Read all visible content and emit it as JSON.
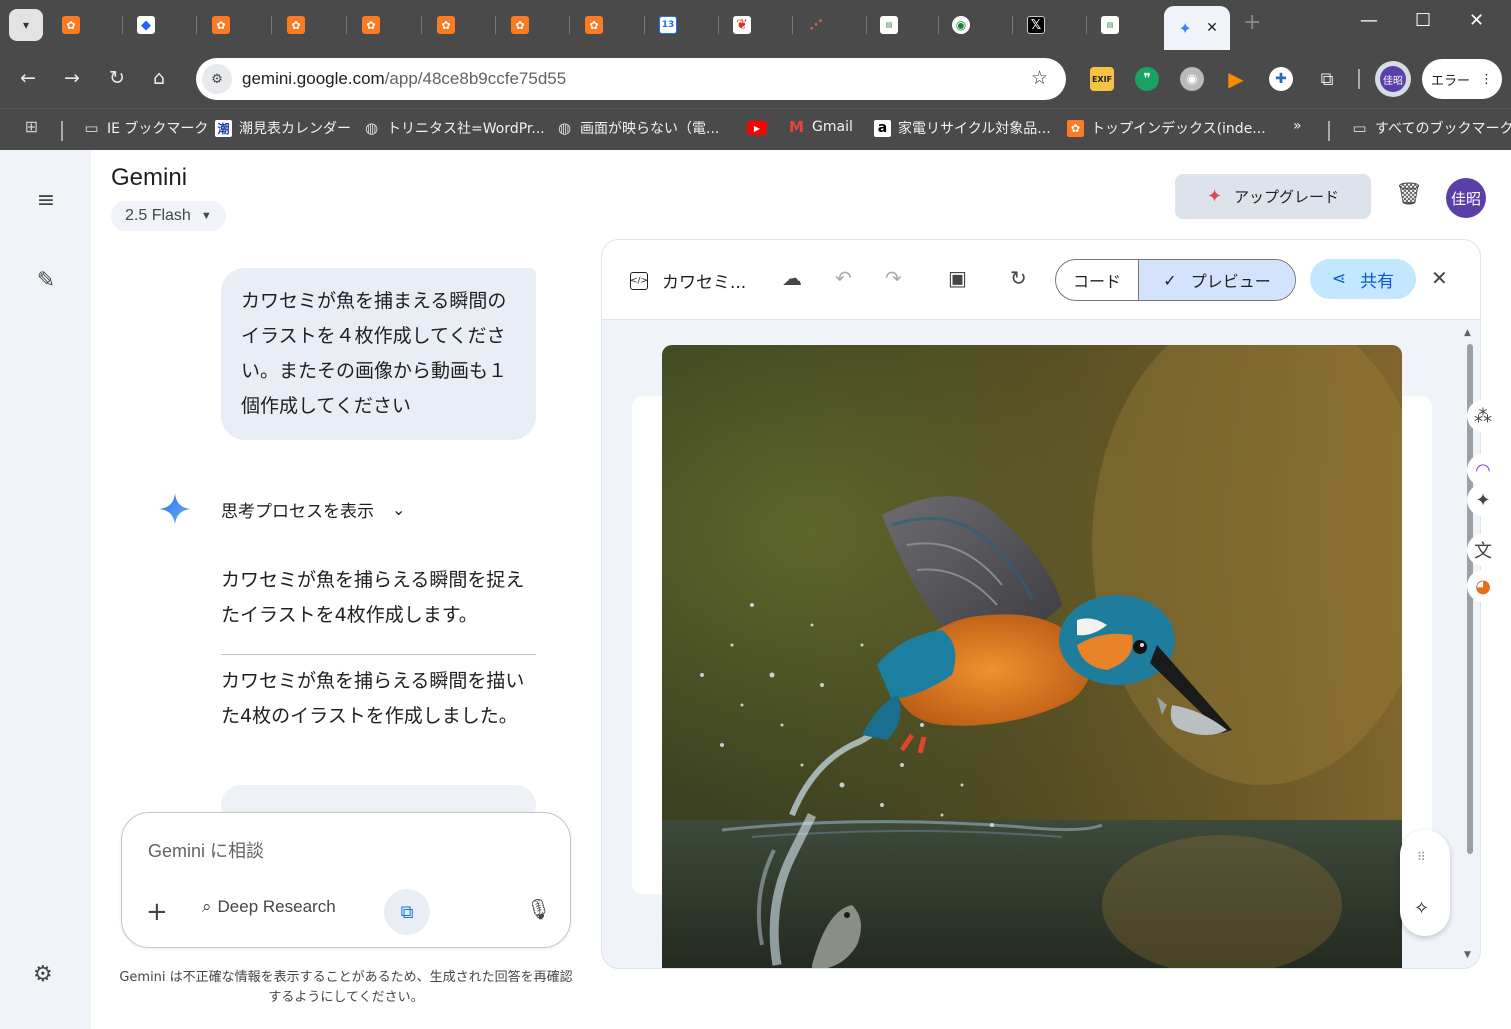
{
  "browser": {
    "tabs": [
      {
        "icon": "xampp-icon"
      },
      {
        "icon": "cube-icon"
      },
      {
        "icon": "xampp-icon"
      },
      {
        "icon": "xampp-icon"
      },
      {
        "icon": "xampp-icon"
      },
      {
        "icon": "xampp-icon"
      },
      {
        "icon": "xampp-icon"
      },
      {
        "icon": "xampp-icon"
      },
      {
        "icon": "calendar-icon",
        "text": "13"
      },
      {
        "icon": "red-logo-icon"
      },
      {
        "icon": "dots-icon"
      },
      {
        "icon": "atdoc-icon"
      },
      {
        "icon": "green-globe-icon"
      },
      {
        "icon": "x-icon"
      },
      {
        "icon": "atdoc-icon"
      }
    ],
    "active_tab_icon": "gemini-spark-icon",
    "url_host": "gemini.google.com",
    "url_path": "/app/48ce8b9ccfe75d55",
    "extensions": [
      "exif-icon",
      "quote-icon",
      "rss-icon",
      "play-icon",
      "gear-icon",
      "puzzle-icon"
    ],
    "profile_initials": "佳昭",
    "error_label": "エラー",
    "bookmarks": [
      {
        "label": "IE ブックマーク",
        "icon": "folder-icon"
      },
      {
        "label": "潮見表カレンダー",
        "icon": "tide-icon",
        "glyph": "潮"
      },
      {
        "label": "トリニタス社=WordPr...",
        "icon": "globe-icon"
      },
      {
        "label": "画面が映らない（電...",
        "icon": "globe-icon"
      },
      {
        "label": "",
        "icon": "youtube-icon"
      },
      {
        "label": "Gmail",
        "icon": "gmail-icon"
      },
      {
        "label": "家電リサイクル対象品...",
        "icon": "amazon-icon"
      },
      {
        "label": "トップインデックス(inde...",
        "icon": "xampp-icon"
      }
    ],
    "all_bookmarks_label": "すべてのブックマーク"
  },
  "app": {
    "title": "Gemini",
    "model": "2.5 Flash",
    "upgrade_label": "アップグレード",
    "avatar_initials": "佳昭",
    "user_message": "カワセミが魚を捕まえる瞬間のイラストを４枚作成してください。またその画像から動画も１個作成してください",
    "thinking_label": "思考プロセスを表示",
    "response_1": "カワセミが魚を捕らえる瞬間を捉えたイラストを4枚作成します。",
    "response_2": "カワセミが魚を捕らえる瞬間を描いた4枚のイラストを作成しました。",
    "composer_placeholder": "Gemini に相談",
    "deep_research_label": "Deep Research",
    "disclaimer": "Gemini は不正確な情報を表示することがあるため、生成された回答を再確認するようにしてください。"
  },
  "canvas": {
    "doc_title": "カワセミ...",
    "code_label": "コード",
    "preview_label": "プレビュー",
    "share_label": "共有"
  },
  "colors": {
    "accent_blue": "#0b57d0",
    "share_bg": "#c2e7ff",
    "preview_toggle_bg": "#d3e3fd",
    "avatar_purple": "#5b3fa8",
    "upgrade_spark": "#e8455a"
  }
}
